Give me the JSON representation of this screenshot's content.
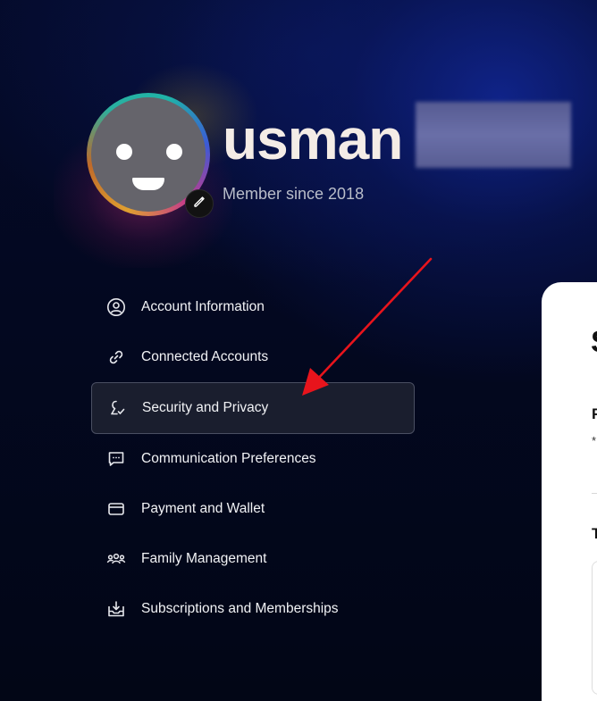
{
  "profile": {
    "username": "usman",
    "member_since": "Member since 2018"
  },
  "menu": {
    "items": [
      {
        "label": "Account Information",
        "icon": "user-circle-icon",
        "active": false
      },
      {
        "label": "Connected Accounts",
        "icon": "link-icon",
        "active": false
      },
      {
        "label": "Security and Privacy",
        "icon": "shield-check-icon",
        "active": true
      },
      {
        "label": "Communication Preferences",
        "icon": "message-icon",
        "active": false
      },
      {
        "label": "Payment and Wallet",
        "icon": "wallet-icon",
        "active": false
      },
      {
        "label": "Family Management",
        "icon": "family-icon",
        "active": false
      },
      {
        "label": "Subscriptions and Memberships",
        "icon": "download-tray-icon",
        "active": false
      }
    ]
  },
  "panel": {
    "heading": "S",
    "section1_initial": "F",
    "section1_note": "*",
    "section2_initial": "T"
  },
  "colors": {
    "background": "#03081e",
    "active_item_bg": "#1a1e2e",
    "arrow": "#e8141c",
    "panel_bg": "#ffffff"
  }
}
